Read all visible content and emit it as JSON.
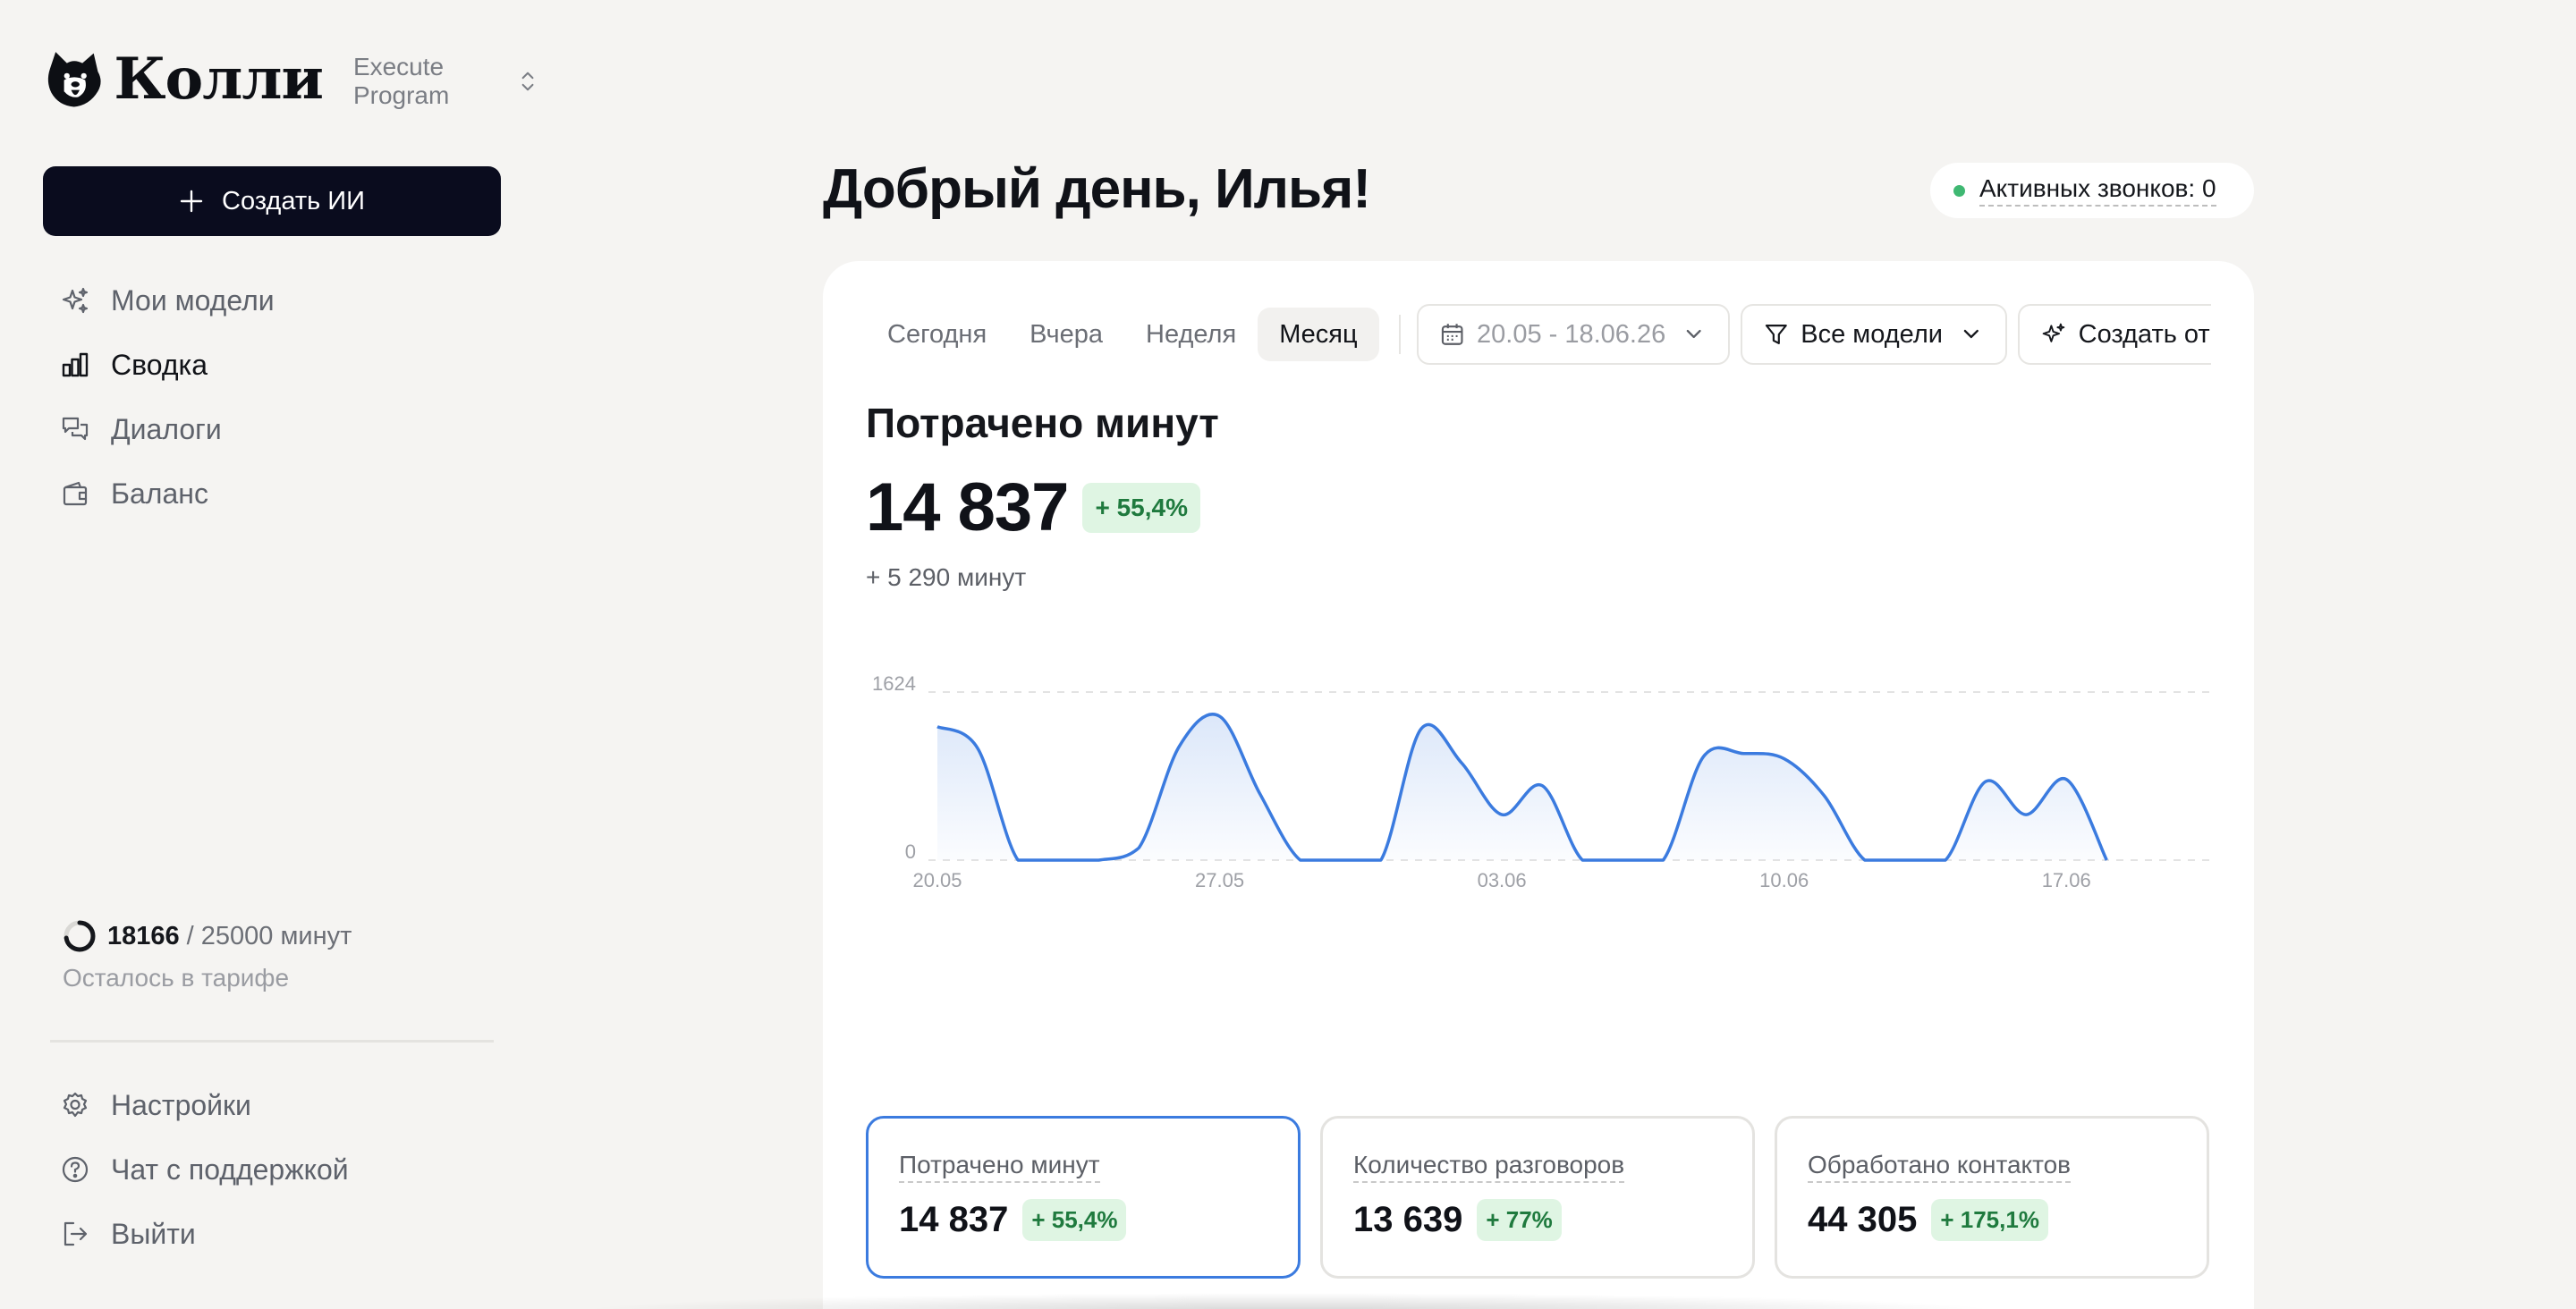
{
  "brand": {
    "name": "Колли",
    "workspace": "Execute Program"
  },
  "sidebar": {
    "create_label": "Создать ИИ",
    "nav": [
      {
        "label": "Мои модели",
        "icon": "sparkles-icon",
        "active": false
      },
      {
        "label": "Сводка",
        "icon": "bar-chart-icon",
        "active": true
      },
      {
        "label": "Диалоги",
        "icon": "chat-icon",
        "active": false
      },
      {
        "label": "Баланс",
        "icon": "wallet-icon",
        "active": false
      }
    ],
    "usage": {
      "used": "18166",
      "total": "/ 25000 минут",
      "subtitle": "Осталось в тарифе",
      "fraction": 0.727
    },
    "bottom_nav": [
      {
        "label": "Настройки",
        "icon": "gear-icon"
      },
      {
        "label": "Чат с поддержкой",
        "icon": "help-icon"
      },
      {
        "label": "Выйти",
        "icon": "logout-icon"
      }
    ]
  },
  "header": {
    "greeting": "Добрый день, Илья!",
    "active_calls": "Активных звонков: 0",
    "status_color": "#3fb872"
  },
  "toolbar": {
    "periods": [
      "Сегодня",
      "Вчера",
      "Неделя",
      "Месяц"
    ],
    "active_period": "Месяц",
    "date_range": "20.05 - 18.06.26",
    "models_filter": "Все модели",
    "report_label": "Создать отчет"
  },
  "metric": {
    "title": "Потрачено минут",
    "value": "14 837",
    "change": "+ 55,4%",
    "delta": "+ 5 290 минут"
  },
  "chart_data": {
    "type": "area",
    "title": "",
    "xlabel": "",
    "ylabel": "",
    "ylim": [
      0,
      1624
    ],
    "y_ticks": [
      "1624",
      "0"
    ],
    "x_ticks": [
      {
        "label": "20.05",
        "day": 0
      },
      {
        "label": "27.05",
        "day": 7
      },
      {
        "label": "03.06",
        "day": 14
      },
      {
        "label": "10.06",
        "day": 21
      },
      {
        "label": "17.06",
        "day": 28
      }
    ],
    "color": "#3b7bdf",
    "grid": "horizontal-dashed",
    "x": [
      "20.05",
      "21.05",
      "22.05",
      "23.05",
      "24.05",
      "25.05",
      "26.05",
      "27.05",
      "28.05",
      "29.05",
      "30.05",
      "31.05",
      "01.06",
      "02.06",
      "03.06",
      "04.06",
      "05.06",
      "06.06",
      "07.06",
      "08.06",
      "09.06",
      "10.06",
      "11.06",
      "12.06",
      "13.06",
      "14.06",
      "15.06",
      "16.06",
      "17.06",
      "18.06"
    ],
    "values": [
      1290,
      1080,
      0,
      0,
      0,
      120,
      1100,
      1390,
      640,
      0,
      0,
      0,
      1270,
      940,
      440,
      720,
      0,
      0,
      0,
      1000,
      1030,
      980,
      620,
      0,
      0,
      0,
      760,
      440,
      780,
      0
    ]
  },
  "stats": [
    {
      "label": "Потрачено минут",
      "value": "14 837",
      "change": "+ 55,4%",
      "active": true
    },
    {
      "label": "Количество разговоров",
      "value": "13 639",
      "change": "+ 77%",
      "active": false
    },
    {
      "label": "Обработано контактов",
      "value": "44 305",
      "change": "+ 175,1%",
      "active": false
    }
  ]
}
